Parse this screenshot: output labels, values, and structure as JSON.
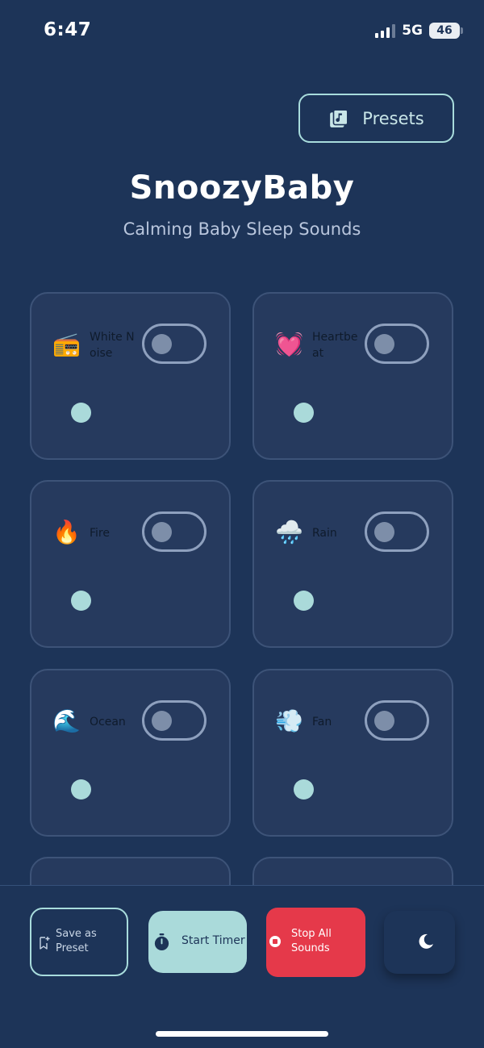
{
  "status_bar": {
    "time": "6:47",
    "network": "5G",
    "battery": "46"
  },
  "header": {
    "presets_label": "Presets",
    "title": "SnoozyBaby",
    "subtitle": "Calming Baby Sleep Sounds"
  },
  "sounds": [
    {
      "name": "White Noise",
      "emoji": "📻",
      "enabled": false
    },
    {
      "name": "Heartbeat",
      "emoji": "💓",
      "enabled": false
    },
    {
      "name": "Fire",
      "emoji": "🔥",
      "enabled": false
    },
    {
      "name": "Rain",
      "emoji": "🌧️",
      "enabled": false
    },
    {
      "name": "Ocean",
      "emoji": "🌊",
      "enabled": false
    },
    {
      "name": "Fan",
      "emoji": "💨",
      "enabled": false
    }
  ],
  "bottom_bar": {
    "save_preset_label": "Save as Preset",
    "start_timer_label": "Start Timer",
    "stop_all_label": "Stop All Sounds"
  },
  "colors": {
    "background": "#1d3458",
    "card": "#263a5e",
    "accent": "#aadada",
    "stop": "#e5394a"
  },
  "icons": {
    "presets": "music-library-icon",
    "save": "bookmark-add-icon",
    "timer": "stopwatch-icon",
    "stop": "stop-circle-icon",
    "theme": "moon-icon"
  }
}
